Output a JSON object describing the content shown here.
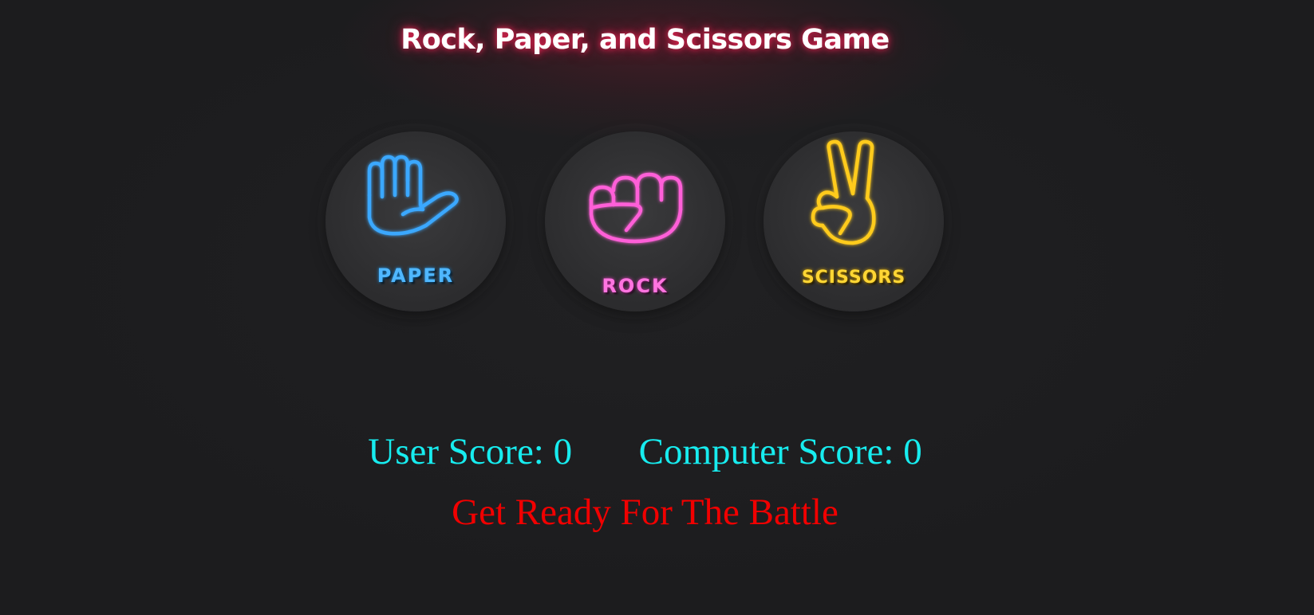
{
  "header": {
    "title": "Rock, Paper, and Scissors Game"
  },
  "choices": [
    {
      "id": "paper",
      "label": "PAPER",
      "icon": "open-hand-icon",
      "color": "#4fb7ff"
    },
    {
      "id": "rock",
      "label": "ROCK",
      "icon": "fist-icon",
      "color": "#ff74e0"
    },
    {
      "id": "scissors",
      "label": "SCISSORS",
      "icon": "victory-hand-icon",
      "color": "#ffd634"
    }
  ],
  "scoreboard": {
    "user_label": "User Score:",
    "user_score": "0",
    "computer_label": "Computer Score:",
    "computer_score": "0"
  },
  "message": {
    "text": "Get Ready For The Battle",
    "color": "#f10000"
  },
  "colors": {
    "background": "#1c1c1e",
    "score_text": "#17ecef",
    "title_glow": "#ff285a"
  }
}
